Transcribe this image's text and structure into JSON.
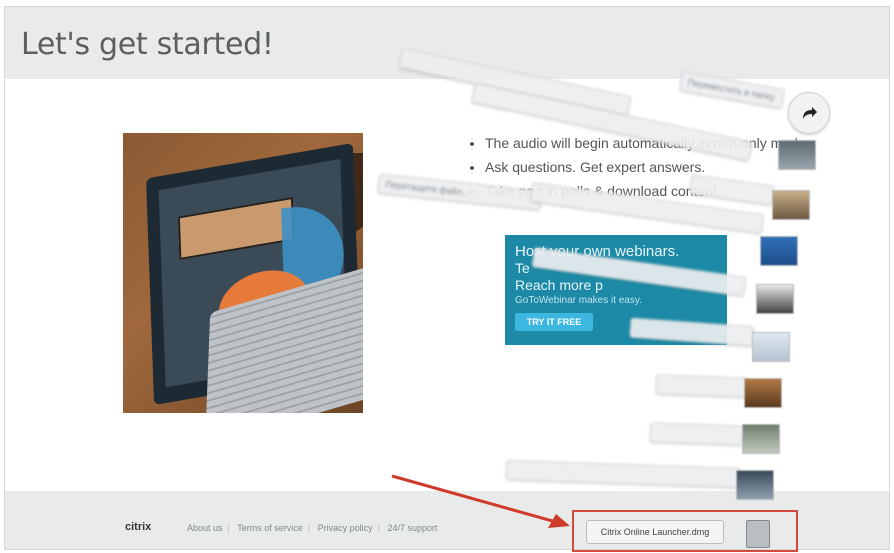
{
  "page": {
    "title": "Let's get started!"
  },
  "content": {
    "bullets": [
      "The audio will begin automatically in non-only mode.",
      "Ask questions. Get expert answers.",
      "Take part in polls & download content."
    ],
    "promo": {
      "line1": "Host your own webinars.",
      "line2": "Te",
      "line3": "Reach more p",
      "line4": "GoToWebinar makes it easy.",
      "button": "TRY IT FREE",
      "extra": ""
    }
  },
  "overlay": {
    "ghost_files": [
      "",
      "",
      "Перетащите файл...",
      "",
      "",
      "",
      "",
      "",
      "",
      ""
    ],
    "ghost_right": [
      "Переместить в папку",
      "",
      ""
    ],
    "share_icon": "share-arrow-icon"
  },
  "footer": {
    "brand": "citrix",
    "links": [
      "About us",
      "Terms of service",
      "Privacy policy",
      "24/7 support"
    ],
    "download_chip": "Citrix Online Launcher.dmg",
    "download_icon": "file-icon"
  },
  "colors": {
    "header_bg": "#e9eaea",
    "promo_bg": "#1c8aa6",
    "highlight": "#d14a3b"
  }
}
